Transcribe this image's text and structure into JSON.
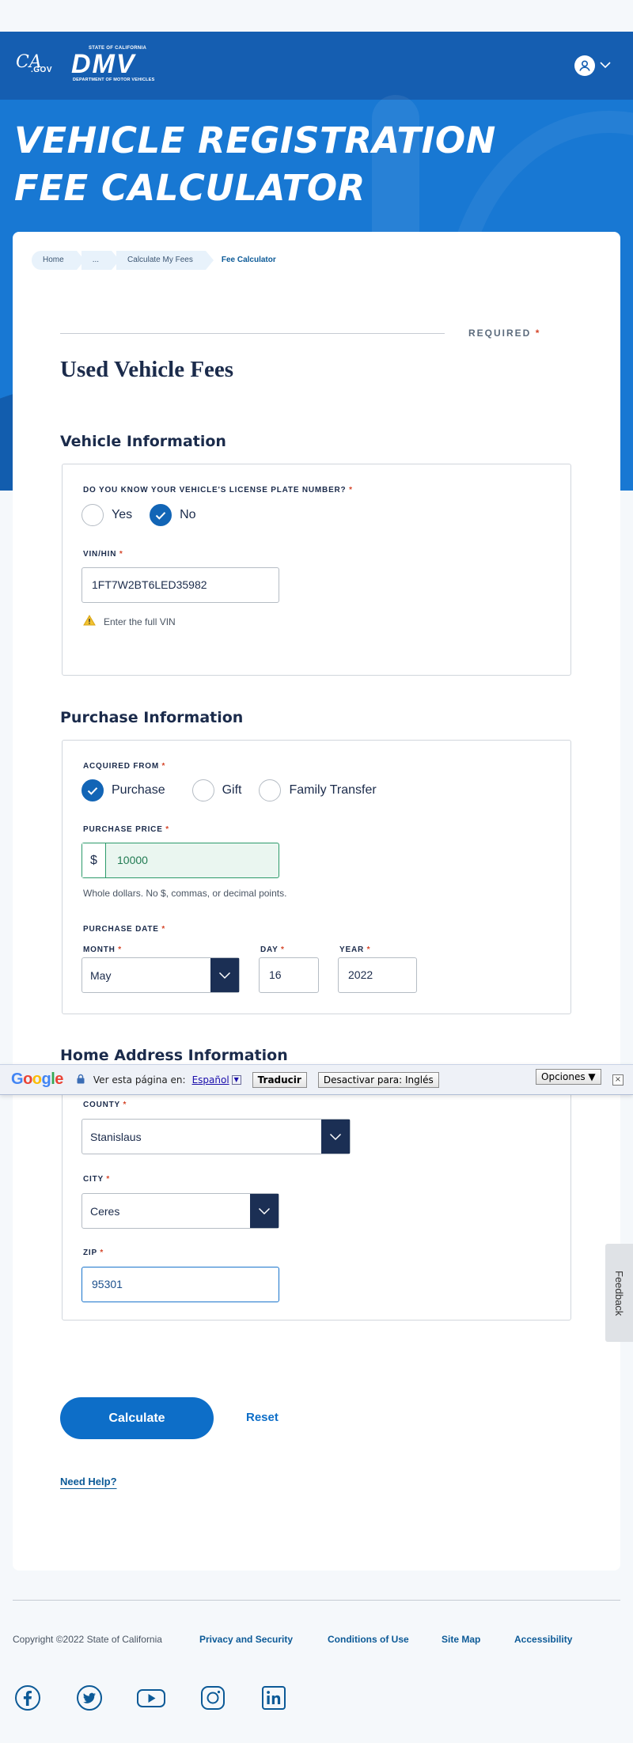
{
  "header": {
    "ca_logo_main": "CA",
    "ca_logo_sub": ".GOV",
    "dmv_logo_state": "STATE OF CALIFORNIA",
    "dmv_logo_main": "DMV",
    "dmv_logo_dept": "DEPARTMENT OF MOTOR VEHICLES",
    "title": "VEHICLE REGISTRATION FEE CALCULATOR"
  },
  "breadcrumb": [
    "Home",
    "...",
    "Calculate My Fees",
    "Fee Calculator"
  ],
  "form": {
    "required_label": "REQUIRED",
    "required_mark": "*",
    "page_title": "Used Vehicle Fees",
    "vehicle_info": {
      "title": "Vehicle Information",
      "plate_question": "DO YOU KNOW YOUR VEHICLE'S LICENSE PLATE NUMBER?",
      "options": [
        "Yes",
        "No"
      ],
      "selected": "No",
      "vin_label": "VIN/HIN",
      "vin_value": "1FT7W2BT6LED35982",
      "vin_warning": "Enter the full VIN"
    },
    "purchase_info": {
      "title": "Purchase Information",
      "acquired_label": "ACQUIRED FROM",
      "options": [
        "Purchase",
        "Gift",
        "Family Transfer"
      ],
      "selected": "Purchase",
      "price_label": "PURCHASE PRICE",
      "price_symbol": "$",
      "price_value": "10000",
      "price_hint": "Whole dollars. No $, commas, or decimal points.",
      "date_label": "PURCHASE DATE",
      "month_label": "MONTH",
      "month_value": "May",
      "day_label": "DAY",
      "day_value": "16",
      "year_label": "YEAR",
      "year_value": "2022"
    },
    "home_address": {
      "title": "Home Address Information",
      "county_label": "COUNTY",
      "county_value": "Stanislaus",
      "city_label": "CITY",
      "city_value": "Ceres",
      "zip_label": "ZIP",
      "zip_value": "95301"
    },
    "calculate_label": "Calculate",
    "reset_label": "Reset",
    "help_label": "Need Help?"
  },
  "translate_bar": {
    "logo": "Google",
    "prompt": "Ver esta página en:",
    "language": "Español",
    "language_toggle": "▼",
    "translate_button": "Traducir",
    "disable_button": "Desactivar para: Inglés",
    "options_button": "Opciones ▼",
    "close": "×"
  },
  "feedback_label": "Feedback",
  "footer": {
    "copyright": "Copyright ©2022 State of California",
    "links": [
      "Privacy and Security",
      "Conditions of Use",
      "Site Map",
      "Accessibility"
    ],
    "social_icons": [
      "facebook-icon",
      "twitter-icon",
      "youtube-icon",
      "instagram-icon",
      "linkedin-icon"
    ]
  },
  "colors": {
    "hero_blue": "#1878d3",
    "header_blue": "#155eb1",
    "navy": "#1b2b4b",
    "primary": "#0d6ec8",
    "required": "#d5462a",
    "valid_green": "#2c9a6a"
  }
}
